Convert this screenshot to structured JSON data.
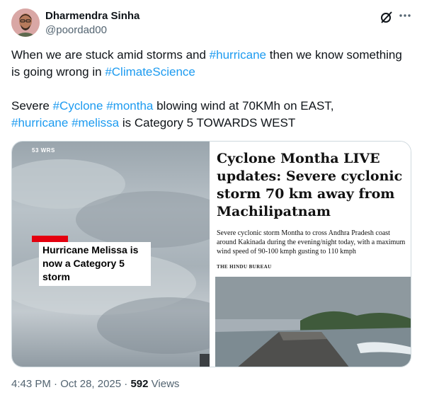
{
  "author": {
    "name": "Dharmendra Sinha",
    "handle": "@poordad00"
  },
  "header_icons": [
    "grok-icon",
    "more-icon"
  ],
  "tweet": {
    "line1_a": "When we are stuck amid storms and ",
    "line1_tag": "#hurricane",
    "line1_b": " then we know something is going wrong in ",
    "line1_tag2": "#ClimateScience",
    "line2_a": "Severe ",
    "line2_tag1": "#Cyclone",
    "line2_tag2": "#montha",
    "line2_b": " blowing wind at 70KMh on EAST,",
    "line3_tag1": "#hurricane",
    "line3_tag2": "#melissa",
    "line3_b": " is Category 5 TOWARDS WEST",
    "space": " "
  },
  "media": {
    "left": {
      "watermark": "53 WRS",
      "caption": "Hurricane Melissa is now a Category 5 storm"
    },
    "right": {
      "headline": "Cyclone Montha LIVE updates: Severe cyclonic storm 70 km away from Machilipatnam",
      "summary": "Severe cyclonic storm Montha to cross Andhra Pradesh coast around Kakinada during the evening/night today, with a maximum wind speed of 90-100 kmph gusting to 110 kmph",
      "byline": "THE HINDU BUREAU"
    }
  },
  "meta": {
    "time": "4:43 PM",
    "sep1": " · ",
    "date": "Oct 28, 2025",
    "sep2": " · ",
    "views_count": "592",
    "views_label": " Views"
  },
  "colors": {
    "link": "#1d9bf0",
    "secondary_text": "#536471",
    "news_red": "#e4000f"
  }
}
